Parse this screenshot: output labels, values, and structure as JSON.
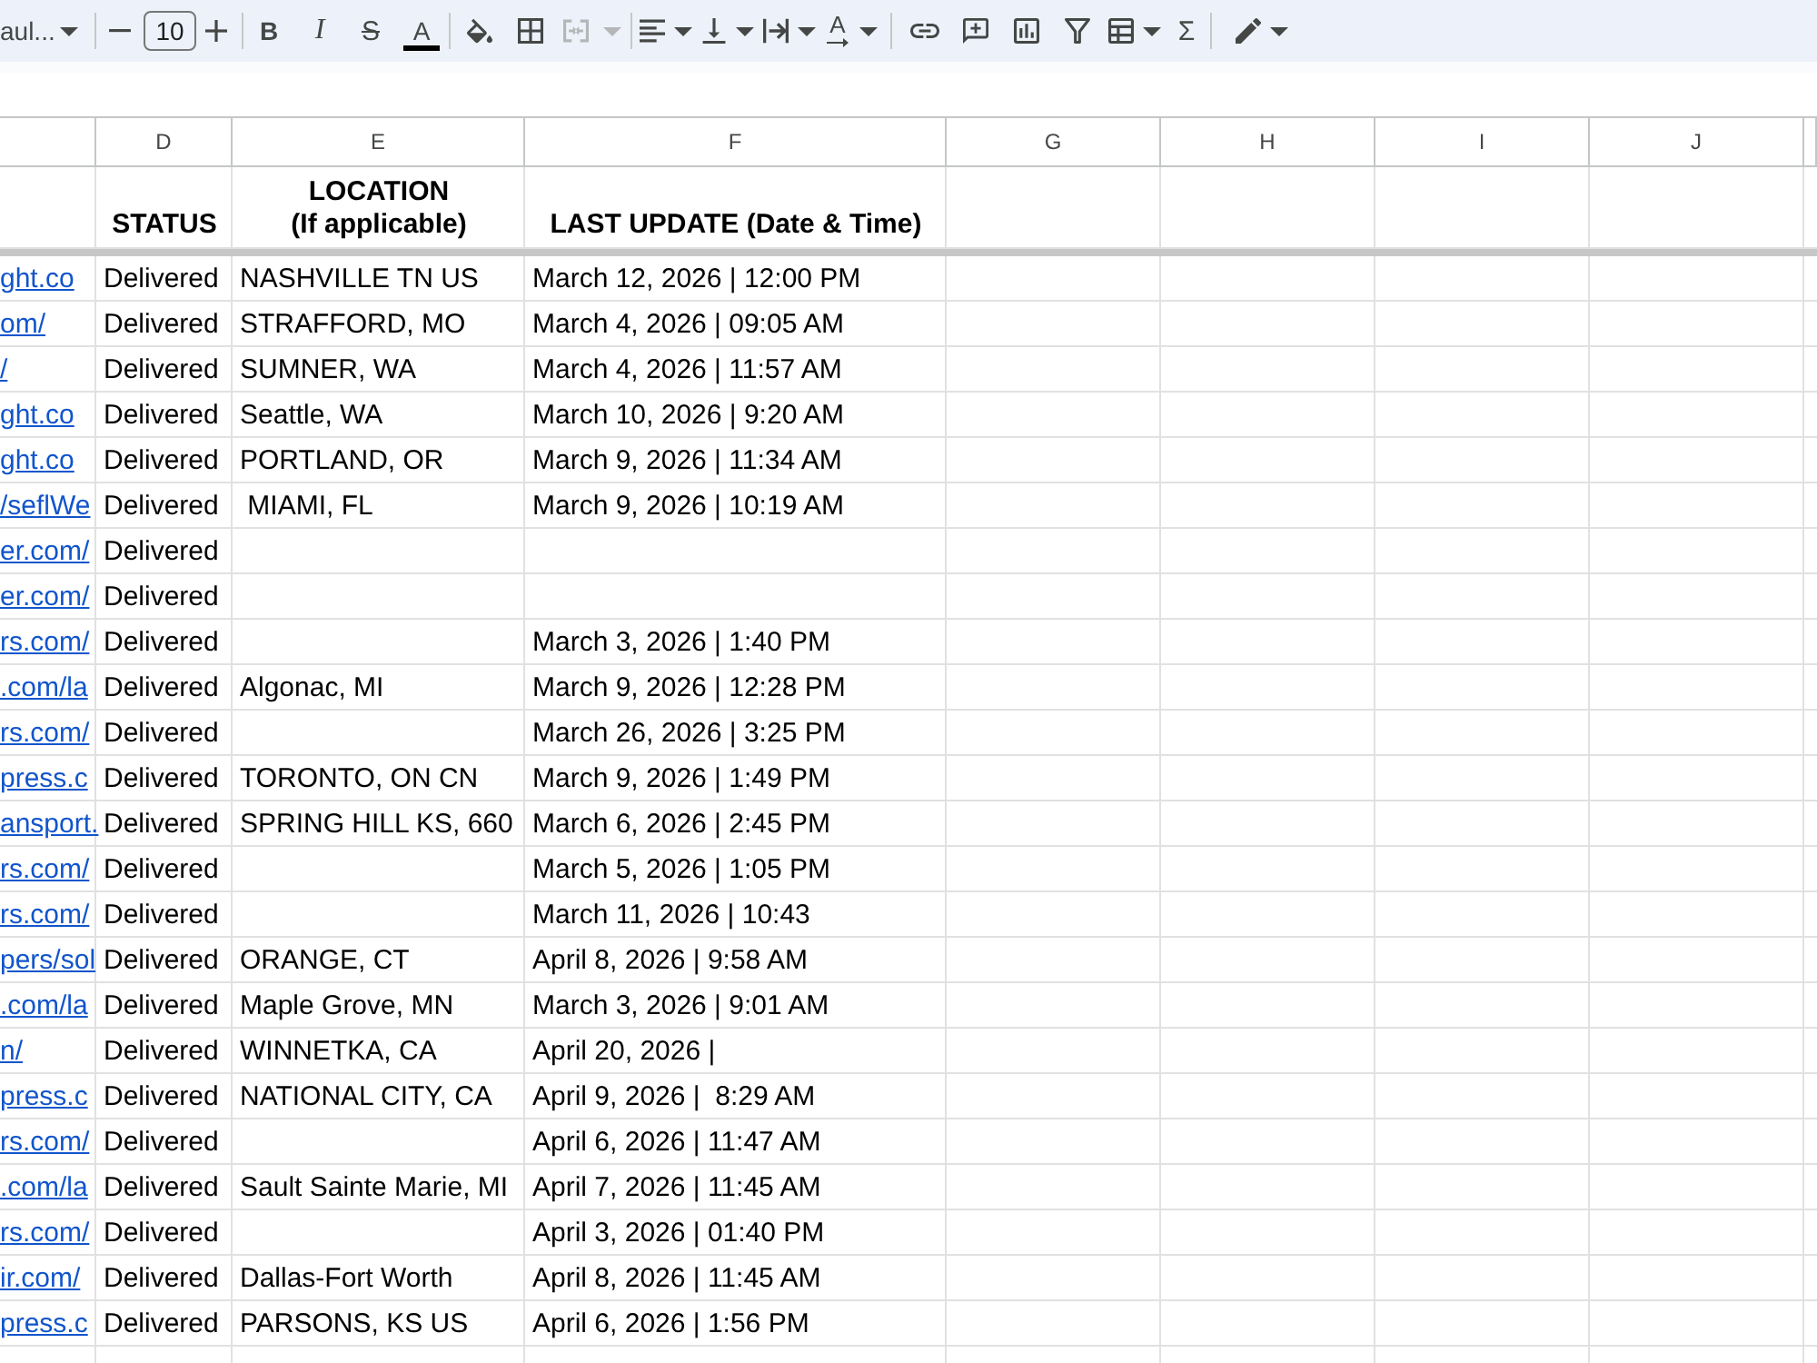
{
  "toolbar": {
    "font_name": "aul...",
    "font_size": "10",
    "bold": "B",
    "italic": "I",
    "strikethrough": "S",
    "text_color": "A",
    "merge_cells": {
      "disabled": true
    },
    "text_rotation": "A",
    "functions": "Σ"
  },
  "sheet": {
    "column_letters": [
      "D",
      "E",
      "F",
      "G",
      "H",
      "I",
      "J"
    ],
    "header_row": [
      "STATUS",
      "LOCATION\n(If applicable)",
      "LAST UPDATE (Date & Time)"
    ],
    "rows": [
      {
        "link": "ght.co",
        "status": "Delivered",
        "location": "NASHVILLE TN US",
        "last_update": "March 12, 2026 | 12:00 PM"
      },
      {
        "link": "om/",
        "status": "Delivered",
        "location": "STRAFFORD, MO",
        "last_update": "March 4, 2026 | 09:05 AM"
      },
      {
        "link": "/",
        "status": "Delivered",
        "location": "SUMNER, WA",
        "last_update": "March 4, 2026 | 11:57 AM"
      },
      {
        "link": "ght.co",
        "status": "Delivered",
        "location": "Seattle, WA",
        "last_update": "March 10, 2026 | 9:20 AM"
      },
      {
        "link": "ght.co",
        "status": "Delivered",
        "location": "PORTLAND, OR",
        "last_update": "March 9, 2026 | 11:34 AM"
      },
      {
        "link": "/seflWe",
        "status": "Delivered",
        "location": " MIAMI, FL",
        "last_update": "March 9, 2026 | 10:19 AM"
      },
      {
        "link": "er.com/",
        "status": "Delivered"
      },
      {
        "link": "er.com/",
        "status": "Delivered"
      },
      {
        "link": "rs.com/",
        "status": "Delivered",
        "last_update": "March 3, 2026 | 1:40 PM"
      },
      {
        "link": ".com/la",
        "status": "Delivered",
        "location": "Algonac, MI",
        "last_update": "March 9, 2026 | 12:28 PM"
      },
      {
        "link": "rs.com/",
        "status": "Delivered",
        "last_update": "March 26, 2026 | 3:25 PM"
      },
      {
        "link": "press.c",
        "status": "Delivered",
        "location": "TORONTO, ON CN",
        "last_update": "March 9, 2026 | 1:49 PM"
      },
      {
        "link": "ansport.",
        "status": "Delivered",
        "location": "SPRING HILL KS, 660",
        "last_update": "March 6, 2026 | 2:45 PM"
      },
      {
        "link": "rs.com/",
        "status": "Delivered",
        "last_update": "March 5, 2026 | 1:05 PM"
      },
      {
        "link": "rs.com/",
        "status": "Delivered",
        "last_update": "March 11, 2026 | 10:43"
      },
      {
        "link": "pers/sol",
        "status": "Delivered",
        "location": "ORANGE, CT",
        "last_update": "April 8, 2026 | 9:58 AM"
      },
      {
        "link": ".com/la",
        "status": "Delivered",
        "location": "Maple Grove, MN",
        "last_update": "March 3, 2026 | 9:01 AM"
      },
      {
        "link": "n/",
        "status": "Delivered",
        "location": "WINNETKA, CA",
        "last_update": "April 20, 2026 |"
      },
      {
        "link": "press.c",
        "status": "Delivered",
        "location": "NATIONAL CITY, CA",
        "last_update": "April 9, 2026 |  8:29 AM"
      },
      {
        "link": "rs.com/",
        "status": "Delivered",
        "last_update": "April 6, 2026 | 11:47 AM"
      },
      {
        "link": ".com/la",
        "status": "Delivered",
        "location": "Sault Sainte Marie, MI",
        "last_update": "April 7, 2026 | 11:45 AM"
      },
      {
        "link": "rs.com/",
        "status": "Delivered",
        "last_update": "April 3, 2026 | 01:40 PM"
      },
      {
        "link": "ir.com/",
        "status": "Delivered",
        "location": "Dallas-Fort Worth",
        "last_update": "April 8, 2026 | 11:45 AM"
      },
      {
        "link": "press.c",
        "status": "Delivered",
        "location": "PARSONS, KS US",
        "last_update": "April 6, 2026 | 1:56 PM"
      }
    ]
  }
}
